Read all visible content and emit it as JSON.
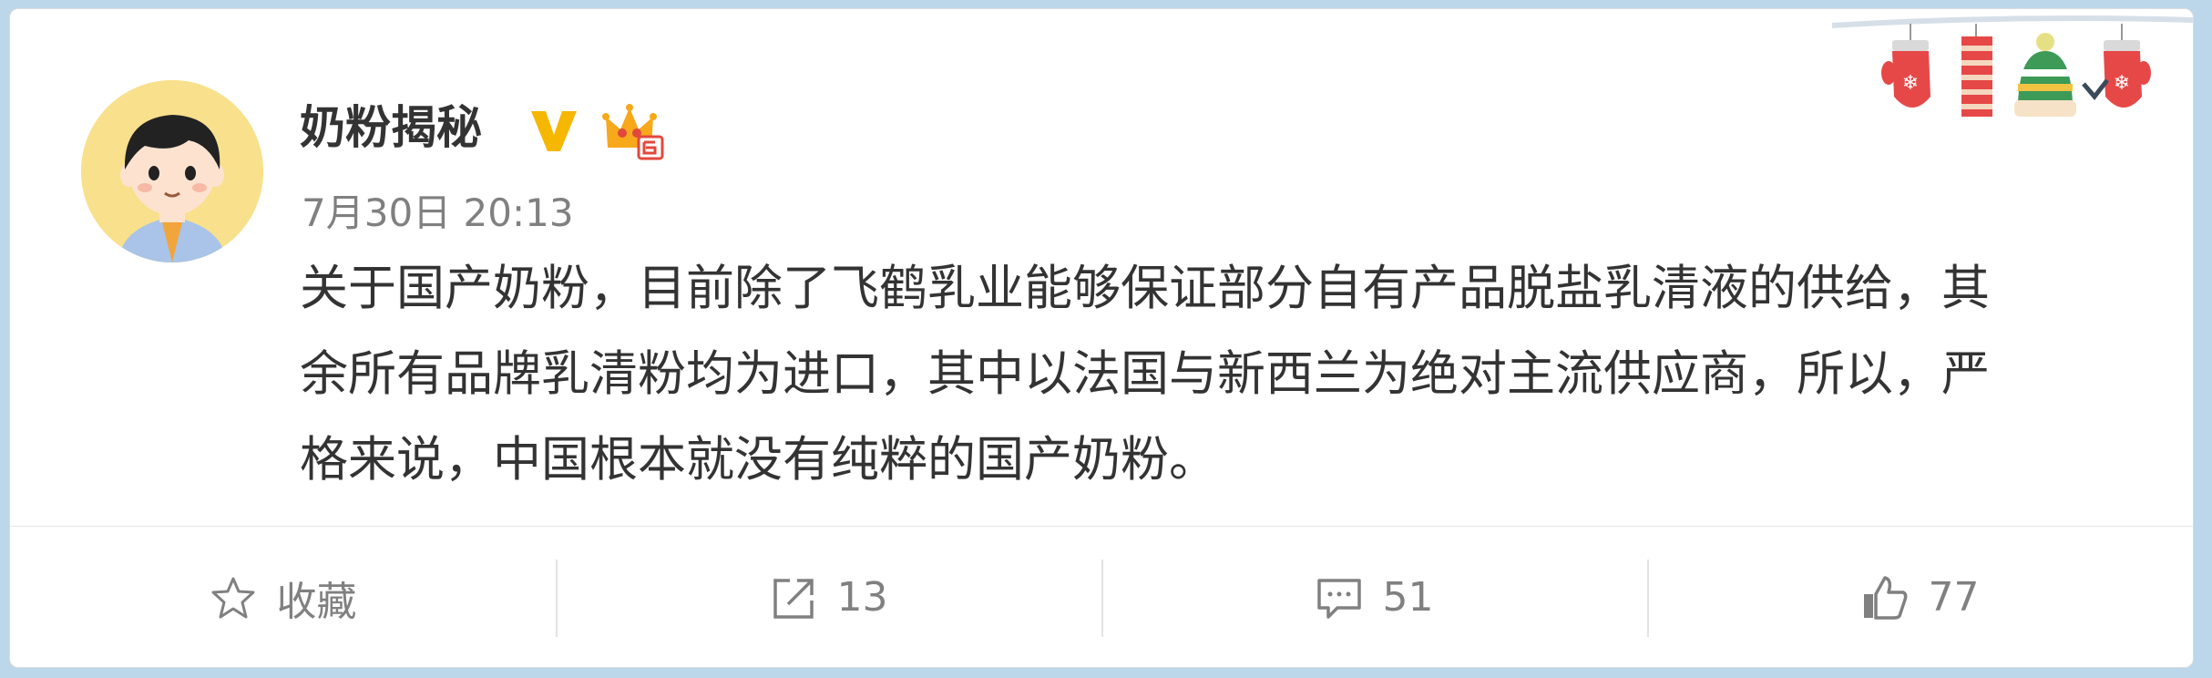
{
  "post": {
    "author": "奶粉揭秘",
    "verified_icon": "v-verified-icon",
    "member_icon": "crown-member-icon",
    "time": "7月30日 20:13",
    "content_lines": [
      "关于国产奶粉，目前除了飞鹤乳业能够保证部分自有产品脱盐乳清液的供给，其",
      "余所有品牌乳清粉均为进口，其中以法国与新西兰为绝对主流供应商，所以，严",
      "格来说，中国根本就没有纯粹的国产奶粉。"
    ]
  },
  "actions": {
    "favorite": {
      "icon": "star-icon",
      "label": "收藏"
    },
    "repost": {
      "icon": "share-icon",
      "label": "13"
    },
    "comment": {
      "icon": "comment-icon",
      "label": "51"
    },
    "like": {
      "icon": "thumbs-up-icon",
      "label": "77"
    }
  },
  "colors": {
    "background": "#bcd6ea",
    "text": "#333333",
    "muted": "#808080",
    "verified": "#f6b700"
  }
}
